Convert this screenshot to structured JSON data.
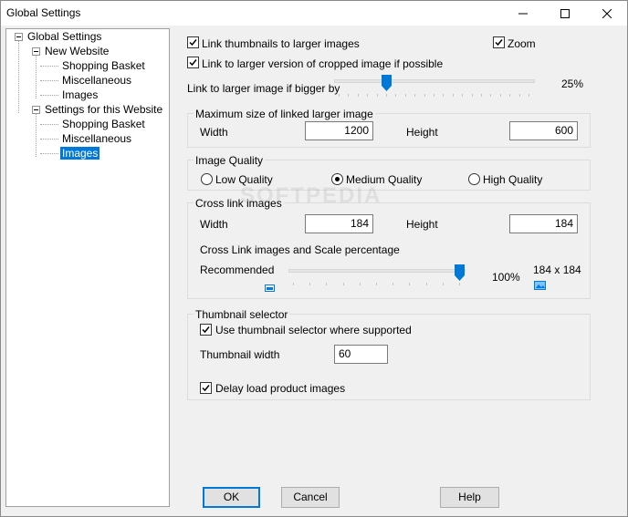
{
  "window": {
    "title": "Global Settings"
  },
  "tree": {
    "root": "Global Settings",
    "new_website": "New Website",
    "new_website_items": [
      "Shopping Basket",
      "Miscellaneous",
      "Images"
    ],
    "this_website": "Settings for this Website",
    "this_website_items": [
      "Shopping Basket",
      "Miscellaneous",
      "Images"
    ],
    "selected": "Images"
  },
  "link": {
    "thumbnails_label": "Link thumbnails to larger images",
    "thumbnails_checked": true,
    "zoom_label": "Zoom",
    "zoom_checked": true,
    "cropped_label": "Link to larger version of cropped image if possible",
    "cropped_checked": true,
    "bigger_label": "Link to larger image if bigger by",
    "bigger_value": "25%",
    "bigger_fraction": 0.25
  },
  "max_size": {
    "title": "Maximum size of linked larger image",
    "width_label": "Width",
    "width_value": "1200",
    "height_label": "Height",
    "height_value": "600"
  },
  "quality": {
    "title": "Image Quality",
    "options": [
      "Low Quality",
      "Medium Quality",
      "High Quality"
    ],
    "selected": "Medium Quality"
  },
  "cross": {
    "title": "Cross link images",
    "width_label": "Width",
    "width_value": "184",
    "height_label": "Height",
    "height_value": "184",
    "scale_label": "Cross Link images and Scale percentage",
    "recommended_label": "Recommended",
    "scale_value": "100%",
    "scale_fraction": 1.0,
    "size_text": "184 x 184"
  },
  "thumb": {
    "title": "Thumbnail selector",
    "use_label": "Use thumbnail selector where supported",
    "use_checked": true,
    "width_label": "Thumbnail width",
    "width_value": "60",
    "delay_label": "Delay load product images",
    "delay_checked": true
  },
  "buttons": {
    "ok": "OK",
    "cancel": "Cancel",
    "help": "Help"
  },
  "watermark": "SOFTPEDIA"
}
